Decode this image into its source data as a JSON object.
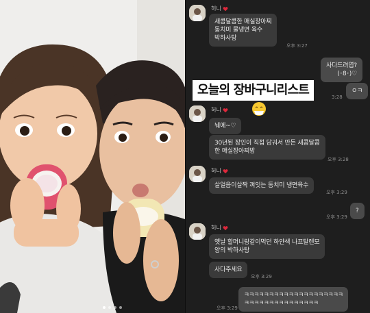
{
  "headline": "오늘의 장바구니리스트",
  "sender_name": "허니",
  "messages": {
    "m1_line1": "새콤달콤한 매실장아찌",
    "m1_line2": "동치미 물냉면 육수",
    "m1_line3": "박하사탕",
    "m1_time": "오후 3:27",
    "r1_line1": "사다드려엽?",
    "r1_line2": "(･8･)♡",
    "r2_text": "ㅇㅋ",
    "r2_time": "3:28",
    "m2_text": "눼에~♡",
    "m3_line1": "30년된 장인이 직접 담궈서 만든 새콤달콤",
    "m3_line2": "한 매실장아찌방",
    "m3_time": "오후 3:28",
    "m4_text": "살얼음이살짝 껴잇는 동치미 냉면육수",
    "m4_time": "오후 3:29",
    "r3_text": "?",
    "r3_time": "오후 3:29",
    "m5_line1": "옛날 할머니랑같이먹던 하얀색 나프탈렌모",
    "m5_line2": "양의 박하사탕",
    "m6_text": "사다주세요",
    "m6_time": "오후 3:29",
    "r4_line1": "ㅋㅋㅋㅋㅋㅋㅋㅋㅋㅋㅋㅋㅋㅋㅋㅋㅋㅋㅋㅋ",
    "r4_line2": "ㅋㅋㅋㅋㅋㅋㅋㅋㅋㅋㅋㅋㅋㅋㅋ",
    "r4_time": "오후 3:29"
  },
  "colors": {
    "chat_bg": "#1e1e1e",
    "bubble": "#3a3a3a",
    "heart": "#e0283c",
    "ice_cream_pink": "#e0526e"
  },
  "icons": {
    "heart": "red-heart-icon",
    "sneeze": "sneezing-face-emoji",
    "avatar": "profile-avatar"
  }
}
